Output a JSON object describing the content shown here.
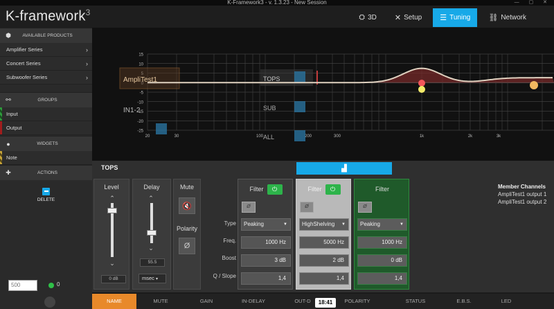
{
  "window": {
    "title": "K-Framework3 - v. 1.3.23 - New Session",
    "controls": "— ▢ ✕"
  },
  "logo": {
    "text": "K-framework",
    "sup": "3"
  },
  "topnav": [
    {
      "label": "3D",
      "icon": "3d-icon",
      "glyph": "⛭"
    },
    {
      "label": "Setup",
      "icon": "wrench-icon",
      "glyph": "✕"
    },
    {
      "label": "Tuning",
      "icon": "tuning-icon",
      "glyph": "☰",
      "active": true
    },
    {
      "label": "Network",
      "icon": "network-icon",
      "glyph": "⛓"
    }
  ],
  "sidebar": {
    "available_products": {
      "header": "AVAILABLE PRODUCTS",
      "items": [
        "Amplifier Series",
        "Concert Series",
        "Subwoofer Series"
      ]
    },
    "groups": {
      "header": "GROUPS",
      "items": [
        "Input",
        "Output"
      ]
    },
    "widgets": {
      "header": "WIDGETS",
      "items": [
        "Note"
      ]
    },
    "actions": {
      "header": "ACTIONS",
      "delete_label": "DELETE"
    },
    "footer": {
      "input_value": "500",
      "count": "0"
    }
  },
  "graph": {
    "y_ticks": [
      "15",
      "10",
      "5",
      "0",
      "-5",
      "-10",
      "-15",
      "-20",
      "-25"
    ],
    "x_ticks": [
      "20",
      "30",
      "100",
      "200",
      "300",
      "1k",
      "2k",
      "3k"
    ],
    "overlays": {
      "ampli": "AmpliTest1",
      "tops": "TOPS",
      "sub": "SUB",
      "all": "ALL",
      "in": "IN1-2"
    },
    "colors": {
      "curve": "#e0d2c0",
      "fill": "#7a2a2a",
      "point_red": "#f2555a",
      "point_yellow": "#f2ea6a",
      "point_orange": "#f2b860"
    }
  },
  "panel": {
    "title": "TOPS",
    "level": {
      "title": "Level",
      "value": "0 dB",
      "up": "⌃",
      "down": "⌄"
    },
    "delay": {
      "title": "Delay",
      "value": "55.5",
      "unit": "msec",
      "up": "⌃",
      "down": "⌄"
    },
    "mute": {
      "title": "Mute",
      "polarity_title": "Polarity",
      "polarity_glyph": "Ø"
    },
    "row_labels": [
      "Type",
      "Freq.",
      "Boost",
      "Q / Slope"
    ],
    "filters": [
      {
        "title": "Filter",
        "enabled": true,
        "phase": "Ø",
        "type": "Peaking",
        "freq": "1000 Hz",
        "boost": "3 dB",
        "q": "1,4"
      },
      {
        "title": "Filter",
        "enabled": true,
        "phase": "Ø",
        "type": "HighShelving",
        "freq": "5000 Hz",
        "boost": "2 dB",
        "q": "1,4"
      },
      {
        "title": "Filter",
        "enabled": false,
        "phase": "Ø",
        "type": "Peaking",
        "freq": "1000 Hz",
        "boost": "0 dB",
        "q": "1,4"
      }
    ],
    "members": {
      "header": "Member Channels",
      "items": [
        "AmpliTest1 output 1",
        "AmpliTest1 output 2"
      ]
    }
  },
  "bottom_tabs": [
    "NAME",
    "MUTE",
    "GAIN",
    "IN-DELAY",
    "OUT-D",
    "POLARITY",
    "STATUS",
    "E.B.S.",
    "LED"
  ],
  "time_badge": "18:41"
}
